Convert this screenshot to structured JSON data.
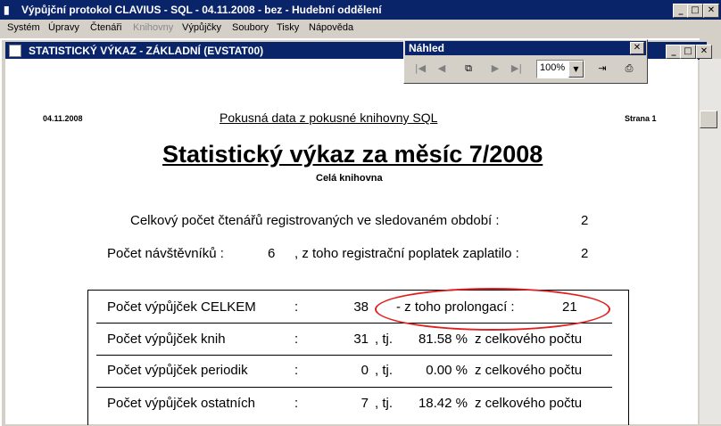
{
  "window": {
    "title": "Výpůjční protokol CLAVIUS - SQL - 04.11.2008 - bez - Hudební oddělení",
    "minimize": "_",
    "maximize": "□",
    "close": "✕"
  },
  "menu": [
    {
      "label": "Systém",
      "enabled": true
    },
    {
      "label": "Úpravy",
      "enabled": true
    },
    {
      "label": "Čtenáři",
      "enabled": true
    },
    {
      "label": "Knihovny",
      "enabled": false
    },
    {
      "label": "Výpůjčky",
      "enabled": true
    },
    {
      "label": "Soubory",
      "enabled": true
    },
    {
      "label": "Tisky",
      "enabled": true
    },
    {
      "label": "Nápověda",
      "enabled": true
    }
  ],
  "child_window": {
    "title": "STATISTICKÝ VÝKAZ - ZÁKLADNÍ (EVSTAT00)"
  },
  "preview": {
    "title": "Náhled",
    "close": "✕",
    "zoom": "100%",
    "dropdown_arrow": "▼"
  },
  "report": {
    "date": "04.11.2008",
    "header": "Pokusná data z pokusné knihovny SQL",
    "page_label": "Strana 1",
    "title": "Statistický výkaz za měsíc 7/2008",
    "subtitle": "Celá knihovna",
    "registered_label": "Celkový počet čtenářů registrovaných ve sledovaném období :",
    "registered_value": "2",
    "visitors_label": "Počet návštěvníků :",
    "visitors_value": "6",
    "fee_label": ", z toho registrační poplatek zaplatilo :",
    "fee_value": "2",
    "rows": [
      {
        "label": "Počet výpůjček CELKEM",
        "colon": ":",
        "value": "38",
        "extra_label": "- z toho prolongací :",
        "extra_value": "21"
      },
      {
        "label": "Počet výpůjček knih",
        "colon": ":",
        "value": "31",
        "tj": ", tj.",
        "pct": "81.58 %",
        "suffix": "z celkového počtu"
      },
      {
        "label": "Počet výpůjček periodik",
        "colon": ":",
        "value": "0",
        "tj": ", tj.",
        "pct": "0.00 %",
        "suffix": "z celkového počtu"
      },
      {
        "label": "Počet výpůjček ostatních",
        "colon": ":",
        "value": "7",
        "tj": ", tj.",
        "pct": "18.42 %",
        "suffix": "z celkového počtu"
      }
    ]
  },
  "colors": {
    "titlebar": "#0a246a",
    "highlight_oval": "#e02020"
  }
}
